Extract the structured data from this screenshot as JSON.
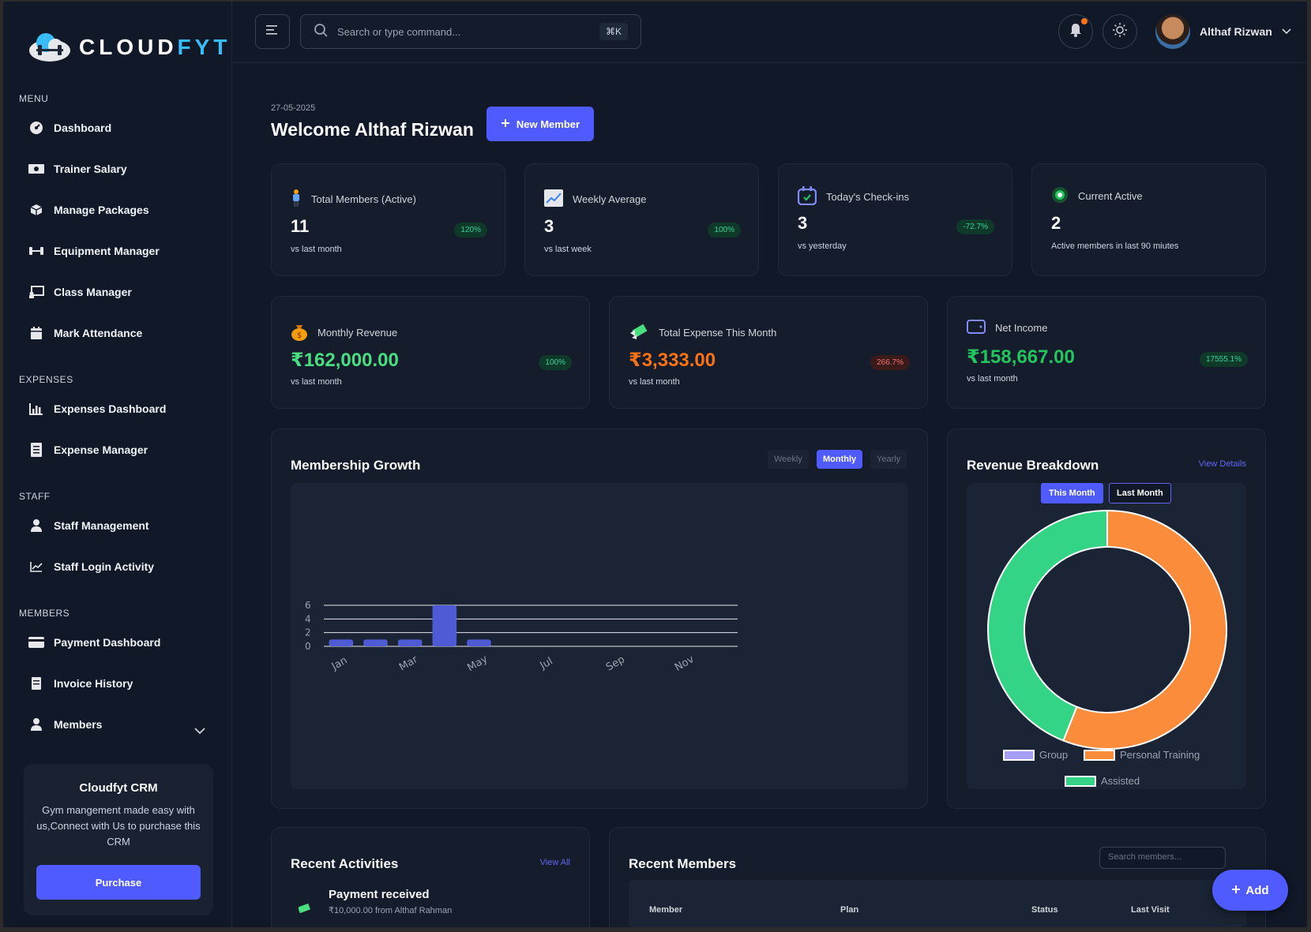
{
  "brand": {
    "name_main": "CLOUD",
    "name_accent": "FYT"
  },
  "sidebar": {
    "sections": {
      "menu": "MENU",
      "expenses": "EXPENSES",
      "staff": "STAFF",
      "members": "MEMBERS"
    },
    "items": [
      {
        "label": "Dashboard",
        "icon": "dashboard-gauge-icon"
      },
      {
        "label": "Trainer Salary",
        "icon": "money-icon"
      },
      {
        "label": "Manage Packages",
        "icon": "package-icon"
      },
      {
        "label": "Equipment Manager",
        "icon": "dumbbell-icon"
      },
      {
        "label": "Class Manager",
        "icon": "chalkboard-icon"
      },
      {
        "label": "Mark Attendance",
        "icon": "calendar-icon"
      },
      {
        "label": "Expenses Dashboard",
        "icon": "bar-chart-icon"
      },
      {
        "label": "Expense Manager",
        "icon": "receipt-icon"
      },
      {
        "label": "Staff Management",
        "icon": "user-icon"
      },
      {
        "label": "Staff Login Activity",
        "icon": "line-chart-icon"
      },
      {
        "label": "Payment Dashboard",
        "icon": "credit-card-icon"
      },
      {
        "label": "Invoice History",
        "icon": "invoice-icon"
      },
      {
        "label": "Members",
        "icon": "user-icon"
      }
    ],
    "promo": {
      "title": "Cloudfyt CRM",
      "description": "Gym mangement made easy with us,Connect with Us to purchase this CRM",
      "button": "Purchase"
    }
  },
  "topbar": {
    "search_placeholder": "Search or type command...",
    "shortcut": "⌘K",
    "user_name": "Althaf Rizwan"
  },
  "header": {
    "date": "27-05-2025",
    "welcome": "Welcome Althaf Rizwan",
    "new_member_button": "New Member"
  },
  "stats": [
    {
      "title": "Total Members (Active)",
      "value": "11",
      "sub": "vs last month",
      "badge": "120%",
      "trend": "green"
    },
    {
      "title": "Weekly Average",
      "value": "3",
      "sub": "vs last week",
      "badge": "100%",
      "trend": "green"
    },
    {
      "title": "Today's Check-ins",
      "value": "3",
      "sub": "vs yesterday",
      "badge": "-72.7%",
      "trend": "green"
    },
    {
      "title": "Current Active",
      "value": "2",
      "sub": "Active members in last 90 miutes",
      "badge": "",
      "trend": ""
    }
  ],
  "finance": [
    {
      "title": "Monthly Revenue",
      "value": "₹162,000.00",
      "sub": "vs last month",
      "badge": "100%",
      "color": "#4ade80"
    },
    {
      "title": "Total Expense This Month",
      "value": "₹3,333.00",
      "sub": "vs last month",
      "badge": "266.7%",
      "color": "#f97316"
    },
    {
      "title": "Net Income",
      "value": "₹158,667.00",
      "sub": "vs last month",
      "badge": "17555.1%",
      "color": "#22c55e"
    }
  ],
  "membership_growth": {
    "title": "Membership Growth",
    "tabs": [
      "Weekly",
      "Monthly",
      "Yearly"
    ],
    "active_tab": "Monthly"
  },
  "revenue_breakdown": {
    "title": "Revenue Breakdown",
    "link": "View Details",
    "pills": [
      "This Month",
      "Last Month"
    ],
    "legend": [
      "Group",
      "Personal Training",
      "Assisted"
    ]
  },
  "recent_activities": {
    "title": "Recent Activities",
    "link": "View All",
    "first_item": "Payment received",
    "first_item_sub": "₹10,000.00 from Althaf Rahman"
  },
  "recent_members": {
    "title": "Recent Members",
    "search_placeholder": "Search members...",
    "columns": [
      "Member",
      "Plan",
      "Status",
      "Last Visit"
    ]
  },
  "fab_label": "Add",
  "colors": {
    "accent": "#4f5bff",
    "positive": "#34d399",
    "negative": "#f87171",
    "bar": "#4f5bd5",
    "donut_green": "#34d486",
    "donut_orange": "#fb8c3c",
    "group": "#a5a0f5"
  },
  "chart_data": [
    {
      "type": "bar",
      "categories": [
        "Jan",
        "Feb",
        "Mar",
        "Apr",
        "May",
        "Jun",
        "Jul",
        "Aug",
        "Sep",
        "Oct",
        "Nov",
        "Dec"
      ],
      "values": [
        1,
        1,
        1,
        6,
        1,
        0,
        0,
        0,
        0,
        0,
        0,
        0
      ],
      "tick_labels_x": [
        "Jan",
        "Mar",
        "May",
        "Jul",
        "Sep",
        "Nov"
      ],
      "yticks": [
        0,
        2,
        4,
        6
      ],
      "ylim": [
        0,
        6
      ],
      "grid": true
    },
    {
      "type": "pie",
      "donut": true,
      "labels": [
        "Group",
        "Personal Training",
        "Assisted"
      ],
      "values": [
        0,
        56,
        44
      ],
      "legend": "bottom"
    }
  ]
}
